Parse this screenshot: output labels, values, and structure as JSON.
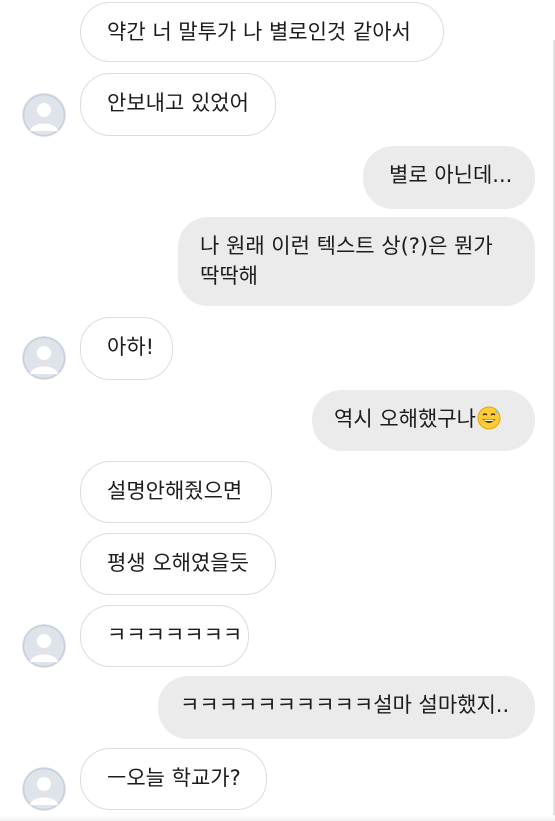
{
  "colors": {
    "incoming_bg": "#ffffff",
    "incoming_border": "#dcdcdc",
    "outgoing_bg": "#ebebeb",
    "avatar_bg": "#dfe3ea",
    "avatar_fg": "#ffffff"
  },
  "messages": [
    {
      "direction": "in",
      "text": "약간 너 말투가 나 별로인것 같아서"
    },
    {
      "direction": "in",
      "text": "안보내고 있었어",
      "avatar": "default-avatar"
    },
    {
      "direction": "out",
      "text": "별로 아닌데..."
    },
    {
      "direction": "out",
      "text": "나 원래 이런 텍스트 상(?)은 뭔가 딱딱해"
    },
    {
      "direction": "in",
      "text": "아하!",
      "avatar": "default-avatar"
    },
    {
      "direction": "out",
      "text": "역시 오해했구나",
      "emoji": "grinning-sweat-emoji"
    },
    {
      "direction": "in",
      "text": "설명안해줬으면"
    },
    {
      "direction": "in",
      "text": "평생 오해였을듯"
    },
    {
      "direction": "in",
      "text": "ㅋㅋㅋㅋㅋㅋㅋ",
      "avatar": "default-avatar"
    },
    {
      "direction": "out",
      "text": "ㅋㅋㅋㅋㅋㅋㅋㅋㅋㅋ설마 설마했지.."
    },
    {
      "direction": "in",
      "text": "ㅡ오늘 학교가?",
      "avatar": "default-avatar"
    }
  ]
}
